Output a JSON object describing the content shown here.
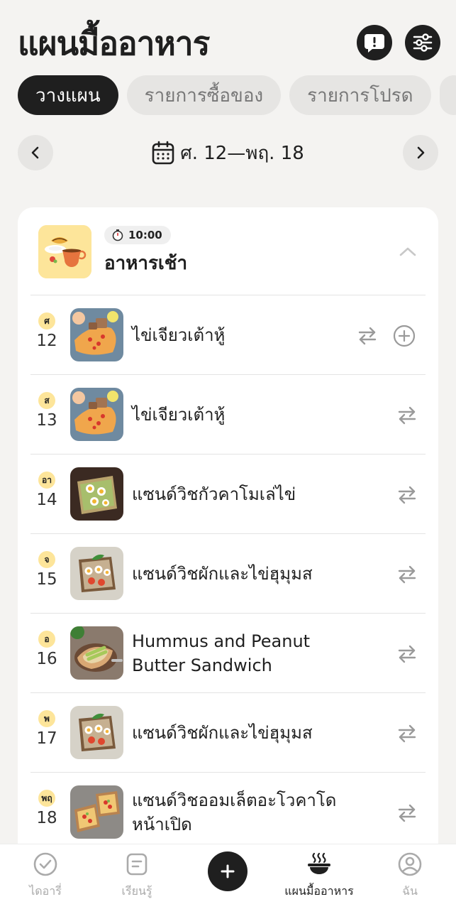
{
  "header": {
    "title": "แผนมื้ออาหาร",
    "alert_icon": "alert-icon",
    "filter_icon": "filter-sliders-icon"
  },
  "tabs": [
    {
      "label": "วางแผน",
      "active": true
    },
    {
      "label": "รายการซื้อของ",
      "active": false
    },
    {
      "label": "รายการโปรด",
      "active": false
    }
  ],
  "date_nav": {
    "range": "ศ. 12—พฤ. 18",
    "prev_icon": "chevron-left-icon",
    "next_icon": "chevron-right-icon",
    "calendar_icon": "calendar-icon"
  },
  "meal": {
    "time": "10:00",
    "name": "อาหารเช้า",
    "icon": "breakfast-icon",
    "timer_icon": "stopwatch-icon",
    "collapse_icon": "chevron-up-icon"
  },
  "rows": [
    {
      "day": "ศ",
      "date": "12",
      "name": "ไข่เจียวเต้าหู้",
      "image": "tofu-omelette"
    },
    {
      "day": "ส",
      "date": "13",
      "name": "ไข่เจียวเต้าหู้",
      "image": "tofu-omelette"
    },
    {
      "day": "อา",
      "date": "14",
      "name": "แซนด์วิชกัวคาโมเล่ไข่",
      "image": "guacamole-egg-toast"
    },
    {
      "day": "จ",
      "date": "15",
      "name": "แซนด์วิชผักและไข่ฮุมุมส",
      "image": "veggie-egg-toast"
    },
    {
      "day": "อ",
      "date": "16",
      "name": "Hummus and Peanut Butter Sandwich",
      "image": "hummus-avocado-toast"
    },
    {
      "day": "พ",
      "date": "17",
      "name": "แซนด์วิชผักและไข่ฮุมุมส",
      "image": "veggie-egg-toast"
    },
    {
      "day": "พฤ",
      "date": "18",
      "name": "แซนด์วิชออมเล็ตอะโวคาโดหน้าเปิด",
      "image": "avocado-omelette-toast"
    }
  ],
  "nav": [
    {
      "label": "ไดอารี่",
      "icon": "check-circle-icon",
      "active": false
    },
    {
      "label": "เรียนรู้",
      "icon": "note-icon",
      "active": false
    },
    {
      "label": "",
      "icon": "plus-icon",
      "active": false
    },
    {
      "label": "แผนมื้ออาหาร",
      "icon": "hot-bowl-icon",
      "active": true
    },
    {
      "label": "ฉัน",
      "icon": "profile-icon",
      "active": false
    }
  ],
  "colors": {
    "background": "#f4f3f1",
    "dark": "#1f1f1f",
    "badge": "#fde59a",
    "pill": "#e6e5e3"
  }
}
